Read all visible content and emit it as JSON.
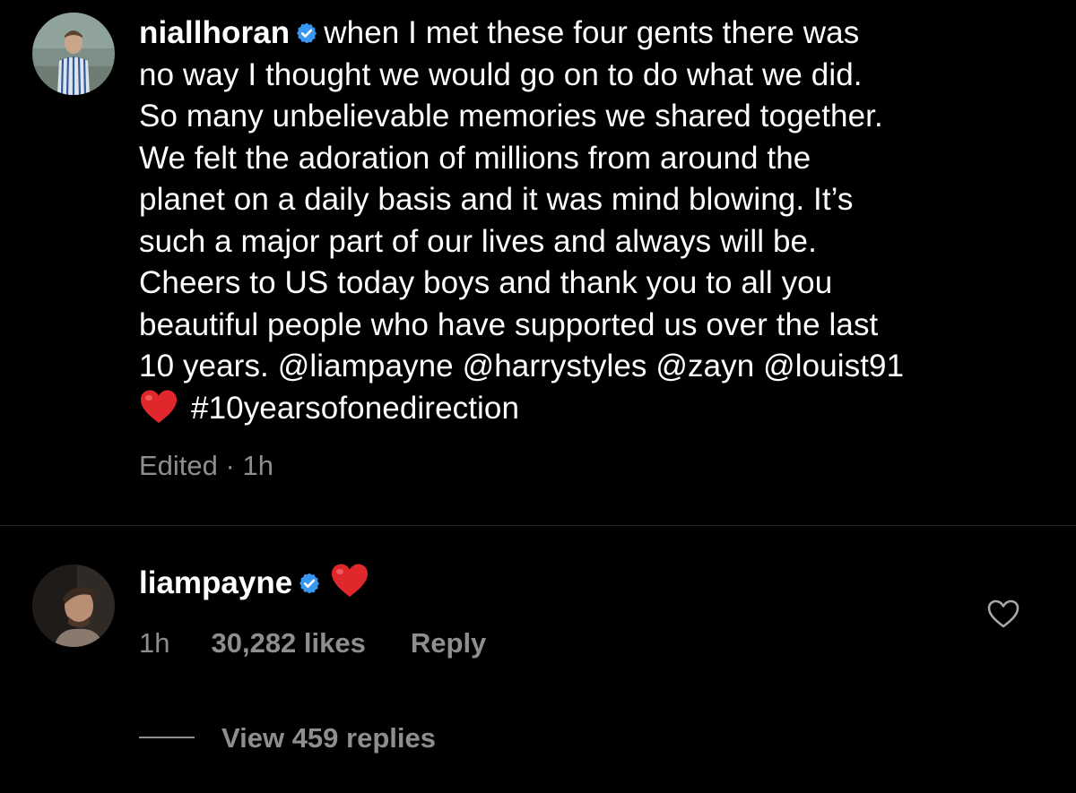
{
  "post": {
    "username": "niallhoran",
    "caption_lines": [
      "when I met these four gents there was",
      "no way I thought we would go on to do what we did.",
      "So many unbelievable memories we shared together.",
      "We felt the adoration of millions from around the",
      "planet on a daily basis and it was mind blowing. It’s",
      "such a major part of our lives and always will be.",
      "Cheers to US today boys and thank you to all you",
      "beautiful people who have supported us over the last",
      "10 years. @liampayne @harrystyles @zayn @louist91"
    ],
    "hashtag": "#10yearsofonedirection",
    "edited_label": "Edited · 1h"
  },
  "comment": {
    "username": "liampayne",
    "time": "1h",
    "likes": "30,282 likes",
    "reply_label": "Reply",
    "view_replies": "View 459 replies"
  },
  "icons": {
    "verified": "verified-badge-icon",
    "heart_emoji": "red-heart-emoji",
    "like": "heart-outline-icon"
  },
  "colors": {
    "background": "#000000",
    "text": "#ffffff",
    "secondary": "#8e8e8e",
    "verified": "#3897f0",
    "heart": "#e0272b"
  }
}
